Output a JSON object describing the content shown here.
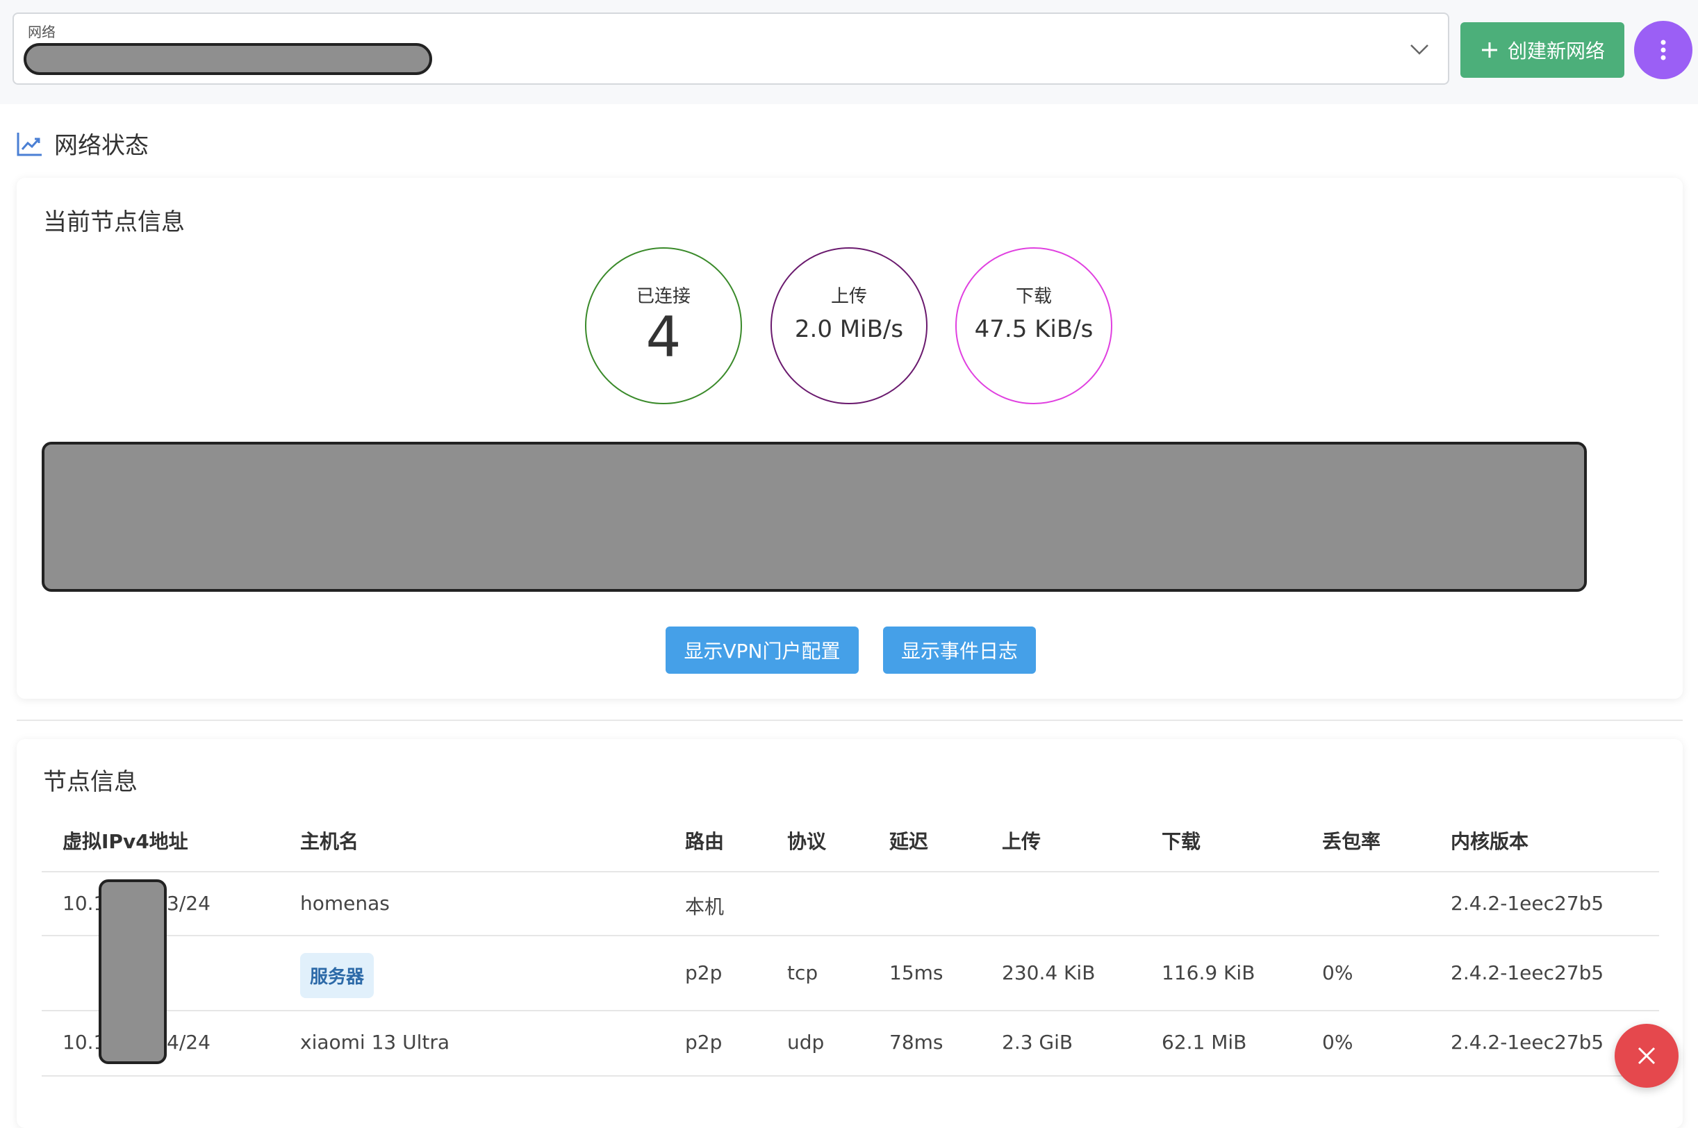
{
  "network": {
    "label": "网络",
    "create_button": "创建新网络"
  },
  "status": {
    "title": "网络状态",
    "node_card_title": "当前节点信息",
    "connected_label": "已连接",
    "connected_value": "4",
    "upload_label": "上传",
    "upload_value": "2.0 MiB/s",
    "download_label": "下载",
    "download_value": "47.5 KiB/s",
    "show_vpn_button": "显示VPN门户配置",
    "show_log_button": "显示事件日志"
  },
  "peers": {
    "title": "节点信息",
    "columns": [
      "虚拟IPv4地址",
      "主机名",
      "路由",
      "协议",
      "延迟",
      "上传",
      "下载",
      "丢包率",
      "内核版本"
    ],
    "rows": [
      {
        "ip_prefix": "10.1",
        "ip_suffix": "3/24",
        "hostname": "homenas",
        "route": "本机",
        "protocol": "",
        "latency": "",
        "upload": "",
        "download": "",
        "loss": "",
        "version": "2.4.2-1eec27b5"
      },
      {
        "ip_prefix": "",
        "ip_suffix": "",
        "hostname": "服务器",
        "route": "p2p",
        "protocol": "tcp",
        "latency": "15ms",
        "upload": "230.4 KiB",
        "download": "116.9 KiB",
        "loss": "0%",
        "version": "2.4.2-1eec27b5"
      },
      {
        "ip_prefix": "10.1",
        "ip_suffix": "4/24",
        "hostname": "xiaomi 13 Ultra",
        "route": "p2p",
        "protocol": "udp",
        "latency": "78ms",
        "upload": "2.3 GiB",
        "download": "62.1 MiB",
        "loss": "0%",
        "version": "2.4.2-1eec27b5"
      }
    ]
  },
  "colors": {
    "connected_ring": "#3a8a2a",
    "upload_ring": "#6a1a6e",
    "download_ring": "#e040e0",
    "create_button": "#4caf7a",
    "more_button": "#9b5ff5",
    "blue_button": "#45a0e8",
    "close_button": "#e5484d"
  },
  "icons": {
    "chevron": "chevron-down-icon",
    "plus": "plus-icon",
    "more": "more-vertical-icon",
    "chart": "trending-chart-icon",
    "close": "close-icon"
  }
}
